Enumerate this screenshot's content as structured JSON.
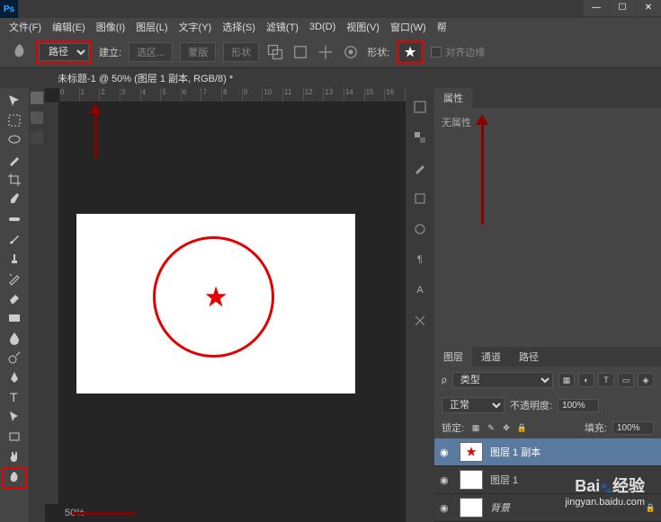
{
  "app": {
    "logo": "Ps"
  },
  "menu": {
    "file": "文件(F)",
    "edit": "编辑(E)",
    "image": "图像(I)",
    "layer": "图层(L)",
    "type": "文字(Y)",
    "select": "选择(S)",
    "filter": "滤镜(T)",
    "threed": "3D(D)",
    "view": "视图(V)",
    "window": "窗口(W)",
    "help": "帮"
  },
  "options": {
    "mode": "路径",
    "build": "建立:",
    "selection": "选区...",
    "mask": "蒙版",
    "shape_btn": "形状",
    "shape_label": "形状:",
    "align": "对齐边缘"
  },
  "document": {
    "tab": "未标题-1 @ 50% (图层 1 副本, RGB/8) *",
    "zoom": "50%"
  },
  "ruler": [
    "0",
    "1",
    "2",
    "3",
    "4",
    "5",
    "6",
    "7",
    "8",
    "9",
    "10",
    "11",
    "12",
    "13",
    "14",
    "15",
    "16"
  ],
  "properties": {
    "tab": "属性",
    "body": "无属性"
  },
  "layers_panel": {
    "tabs": {
      "layers": "图层",
      "channels": "通道",
      "paths": "路径"
    },
    "kind": "类型",
    "blend": "正常",
    "opacity_label": "不透明度:",
    "opacity": "100%",
    "lock_label": "锁定:",
    "fill_label": "填充:",
    "fill": "100%",
    "layers": [
      {
        "name": "图层 1 副本",
        "selected": true
      },
      {
        "name": "图层 1",
        "selected": false
      },
      {
        "name": "背景",
        "selected": false,
        "locked": true
      }
    ]
  },
  "watermark": {
    "brand": "Bai",
    "brand2": "经验",
    "url": "jingyan.baidu.com"
  }
}
